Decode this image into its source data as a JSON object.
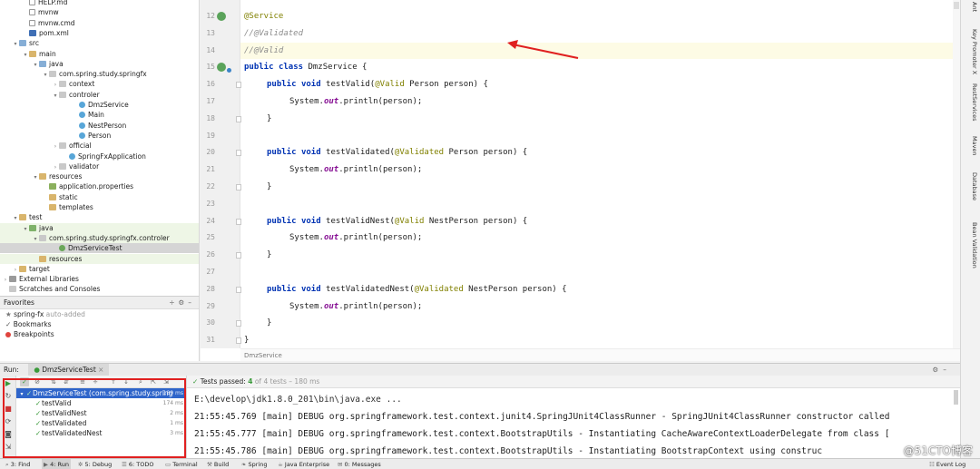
{
  "project_tree": [
    {
      "label": "HELP.md",
      "icon": "file-icon"
    },
    {
      "label": "mvnw",
      "icon": "file-icon"
    },
    {
      "label": "mvnw.cmd",
      "icon": "file-icon"
    },
    {
      "label": "pom.xml",
      "icon": "maven-icon"
    },
    {
      "label": "src",
      "icon": "folder-icon"
    },
    {
      "label": "main",
      "icon": "folder-icon"
    },
    {
      "label": "java",
      "icon": "folder-icon"
    },
    {
      "label": "com.spring.study.springfx",
      "icon": "package-icon"
    },
    {
      "label": "context",
      "icon": "package-icon"
    },
    {
      "label": "controler",
      "icon": "package-icon"
    },
    {
      "label": "DmzService",
      "icon": "class-icon"
    },
    {
      "label": "Main",
      "icon": "class-icon"
    },
    {
      "label": "NestPerson",
      "icon": "class-icon"
    },
    {
      "label": "Person",
      "icon": "class-icon"
    },
    {
      "label": "official",
      "icon": "package-icon"
    },
    {
      "label": "SpringFxApplication",
      "icon": "class-icon"
    },
    {
      "label": "validator",
      "icon": "package-icon"
    },
    {
      "label": "resources",
      "icon": "folder-icon"
    },
    {
      "label": "application.properties",
      "icon": "properties-icon"
    },
    {
      "label": "static",
      "icon": "folder-icon"
    },
    {
      "label": "templates",
      "icon": "folder-icon"
    },
    {
      "label": "test",
      "icon": "folder-icon"
    },
    {
      "label": "java",
      "icon": "folder-icon"
    },
    {
      "label": "com.spring.study.springfx.controler",
      "icon": "package-icon"
    },
    {
      "label": "DmzServiceTest",
      "icon": "test-class-icon"
    },
    {
      "label": "resources",
      "icon": "folder-icon"
    },
    {
      "label": "target",
      "icon": "folder-icon"
    },
    {
      "label": "External Libraries",
      "icon": "library-icon"
    },
    {
      "label": "Scratches and Consoles",
      "icon": "scratch-icon"
    }
  ],
  "favorites": {
    "title": "Favorites",
    "items": [
      {
        "label": "spring-fx",
        "note": "auto-added"
      },
      {
        "label": "Bookmarks",
        "note": ""
      },
      {
        "label": "Breakpoints",
        "note": ""
      }
    ]
  },
  "editor": {
    "lines": [
      {
        "num": "12",
        "text": "@Service"
      },
      {
        "num": "13",
        "text": "//@Validated"
      },
      {
        "num": "14",
        "text": "//@Valid"
      },
      {
        "num": "15",
        "text": "public class DmzService {"
      },
      {
        "num": "16",
        "text": "public void testValid(@Valid Person person) {"
      },
      {
        "num": "17",
        "text": "System.out.println(person);"
      },
      {
        "num": "18",
        "text": "}"
      },
      {
        "num": "19",
        "text": ""
      },
      {
        "num": "20",
        "text": "public void testValidated(@Validated Person person) {"
      },
      {
        "num": "21",
        "text": "System.out.println(person);"
      },
      {
        "num": "22",
        "text": "}"
      },
      {
        "num": "23",
        "text": ""
      },
      {
        "num": "24",
        "text": "public void testValidNest(@Valid NestPerson person) {"
      },
      {
        "num": "25",
        "text": "System.out.println(person);"
      },
      {
        "num": "26",
        "text": "}"
      },
      {
        "num": "27",
        "text": ""
      },
      {
        "num": "28",
        "text": "public void testValidatedNest(@Validated NestPerson person) {"
      },
      {
        "num": "29",
        "text": "System.out.println(person);"
      },
      {
        "num": "30",
        "text": "}"
      },
      {
        "num": "31",
        "text": "}"
      }
    ],
    "breadcrumb": "DmzService"
  },
  "right_tabs": [
    "Ant",
    "Key Promoter X",
    "RestServices",
    "Maven",
    "Database",
    "Bean Validation"
  ],
  "run": {
    "label": "Run:",
    "tab": "DmzServiceTest",
    "status_prefix": "Tests passed:",
    "passed": "4",
    "status_suffix": "of 4 tests – 180 ms",
    "tests": [
      {
        "name": "DmzServiceTest (com.spring.study.spring",
        "time": "180 ms"
      },
      {
        "name": "testValid",
        "time": "174 ms"
      },
      {
        "name": "testValidNest",
        "time": "2 ms"
      },
      {
        "name": "testValidated",
        "time": "1 ms"
      },
      {
        "name": "testValidatedNest",
        "time": "3 ms"
      }
    ],
    "console": [
      "E:\\develop\\jdk1.8.0_201\\bin\\java.exe ...",
      "21:55:45.769 [main] DEBUG org.springframework.test.context.junit4.SpringJUnit4ClassRunner - SpringJUnit4ClassRunner constructor called",
      "21:55:45.777 [main] DEBUG org.springframework.test.context.BootstrapUtils - Instantiating CacheAwareContextLoaderDelegate from class [",
      "21:55:45.786 [main] DEBUG org.springframework.test.context.BootstrapUtils - Instantiating BootstrapContext using construc"
    ]
  },
  "bottom_bar": [
    {
      "label": "3: Find"
    },
    {
      "label": "4: Run"
    },
    {
      "label": "5: Debug"
    },
    {
      "label": "6: TODO"
    },
    {
      "label": "Terminal"
    },
    {
      "label": "Build"
    },
    {
      "label": "Spring"
    },
    {
      "label": "Java Enterprise"
    },
    {
      "label": "0: Messages"
    },
    {
      "label": "Event Log"
    }
  ],
  "watermark": "@51CTO博客",
  "colors": {
    "accent": "#2f65ca",
    "pass": "#3a9a3a",
    "annotation_box": "#e02020"
  }
}
